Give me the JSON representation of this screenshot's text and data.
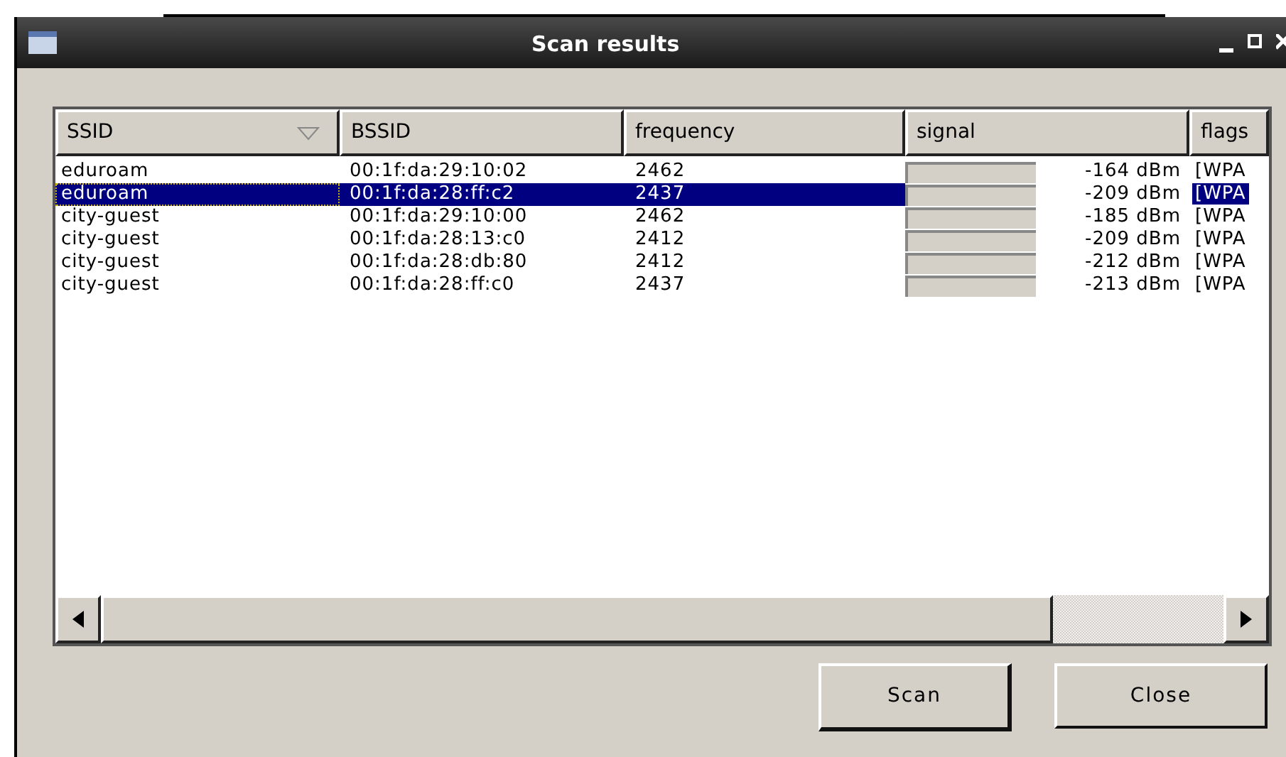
{
  "window": {
    "title": "Scan results"
  },
  "table": {
    "columns": [
      {
        "label": "SSID",
        "sorted": true
      },
      {
        "label": "BSSID",
        "sorted": false
      },
      {
        "label": "frequency",
        "sorted": false
      },
      {
        "label": "signal",
        "sorted": false
      },
      {
        "label": "flags"
      }
    ],
    "rows": [
      {
        "ssid": "eduroam",
        "bssid": "00:1f:da:29:10:02",
        "frequency": "2462",
        "signal": "-164 dBm",
        "flags": "[WPA",
        "selected": false
      },
      {
        "ssid": "eduroam",
        "bssid": "00:1f:da:28:ff:c2",
        "frequency": "2437",
        "signal": "-209 dBm",
        "flags": "[WPA",
        "selected": true
      },
      {
        "ssid": "city-guest",
        "bssid": "00:1f:da:29:10:00",
        "frequency": "2462",
        "signal": "-185 dBm",
        "flags": "[WPA",
        "selected": false
      },
      {
        "ssid": "city-guest",
        "bssid": "00:1f:da:28:13:c0",
        "frequency": "2412",
        "signal": "-209 dBm",
        "flags": "[WPA",
        "selected": false
      },
      {
        "ssid": "city-guest",
        "bssid": "00:1f:da:28:db:80",
        "frequency": "2412",
        "signal": "-212 dBm",
        "flags": "[WPA",
        "selected": false
      },
      {
        "ssid": "city-guest",
        "bssid": "00:1f:da:28:ff:c0",
        "frequency": "2437",
        "signal": "-213 dBm",
        "flags": "[WPA",
        "selected": false
      }
    ]
  },
  "buttons": [
    {
      "label": "Scan",
      "default": true
    },
    {
      "label": "Close",
      "default": false
    }
  ]
}
